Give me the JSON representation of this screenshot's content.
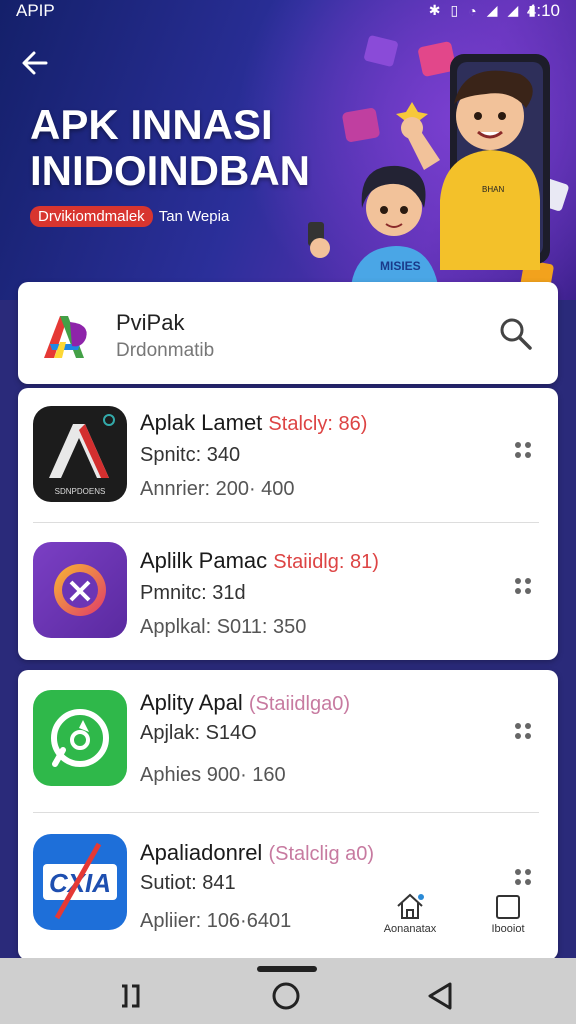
{
  "status_bar": {
    "app": "APIP",
    "time": "4:10"
  },
  "hero": {
    "title_line1": "APK INNASI",
    "title_line2": "INIDOINDBAN",
    "subtitle_pill": "Drvikiomdmalek",
    "subtitle_rest": "Tan Wepia",
    "shirt_text": "MISIES"
  },
  "header": {
    "app_name": "PviPak",
    "app_desc": "Drdonmatib"
  },
  "apps": [
    {
      "title": "Aplak Lamet",
      "status": "Stalcly: 86)",
      "line2": "Spnitc: 340",
      "line3": "Annrier: 200· 400",
      "icon_text": "SDNPDOENS"
    },
    {
      "title": "Aplilk Pamac",
      "status": "Staiidlg: 81)",
      "line2": "Pmnitc: 31d",
      "line3": "Applkal: S011: 350"
    },
    {
      "title": "Aplity Apal",
      "status": "(Staiidlga0)",
      "line2": "Apjlak: S14O",
      "line3": "Aphies 900· 160"
    },
    {
      "title": "Apaliadonrel",
      "status": "(Stalclig a0)",
      "line2": "Sutiot: 841",
      "line3": "Apliier: 106·6401"
    }
  ],
  "bottom_tabs": [
    {
      "label": "Aonanatax"
    },
    {
      "label": "Ibooiot"
    }
  ],
  "colors": {
    "accent_red": "#d8352f",
    "card": "#ffffff",
    "hero_dark": "#14206a"
  }
}
